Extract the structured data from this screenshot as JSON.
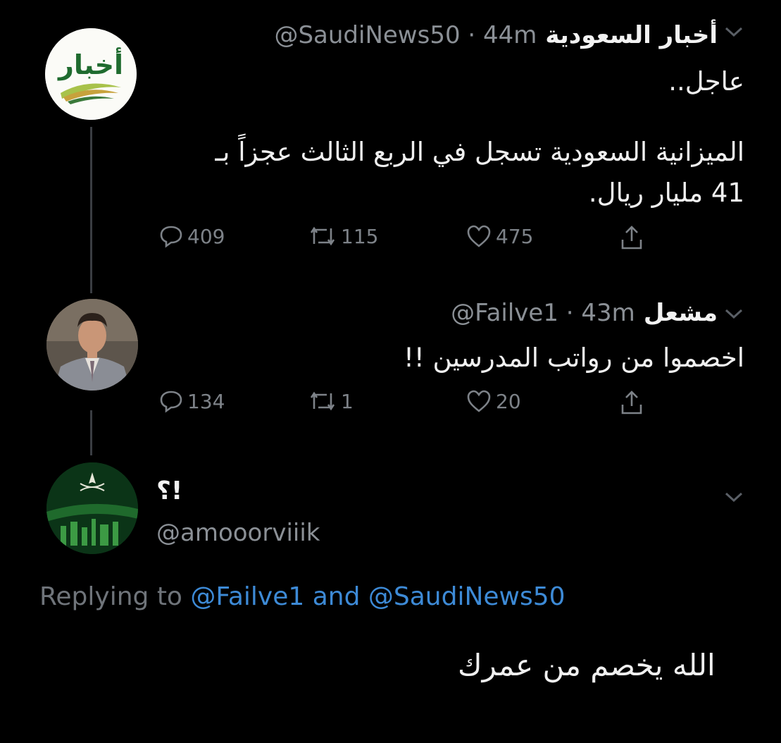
{
  "tweet1": {
    "name": "أخبار السعودية",
    "handle": "@SaudiNews50",
    "time": "44m",
    "avatar_text": "أخبار",
    "line1": "عاجل..",
    "line2": "الميزانية السعودية تسجل في الربع الثالث عجزاً بـ",
    "line3": "41 مليار ريال.",
    "replies": "409",
    "retweets": "115",
    "likes": "475"
  },
  "tweet2": {
    "name": "مشعل",
    "handle": "@Failve1",
    "time": "43m",
    "text": "اخصموا من رواتب المدرسين !!",
    "replies": "134",
    "retweets": "1",
    "likes": "20"
  },
  "tweet3": {
    "name": "؟!",
    "handle": "@amooorviiik",
    "replying_prefix": "Replying to",
    "reply_user1": "@Failve1",
    "reply_and": "and",
    "reply_user2": "@SaudiNews50",
    "text": "الله يخصم من عمرك"
  },
  "icons": [
    "reply-icon",
    "retweet-icon",
    "like-icon",
    "share-icon",
    "chevron-down-icon"
  ],
  "colors": {
    "background": "#000000",
    "link": "#3d8ad6",
    "muted": "#7d8288"
  }
}
